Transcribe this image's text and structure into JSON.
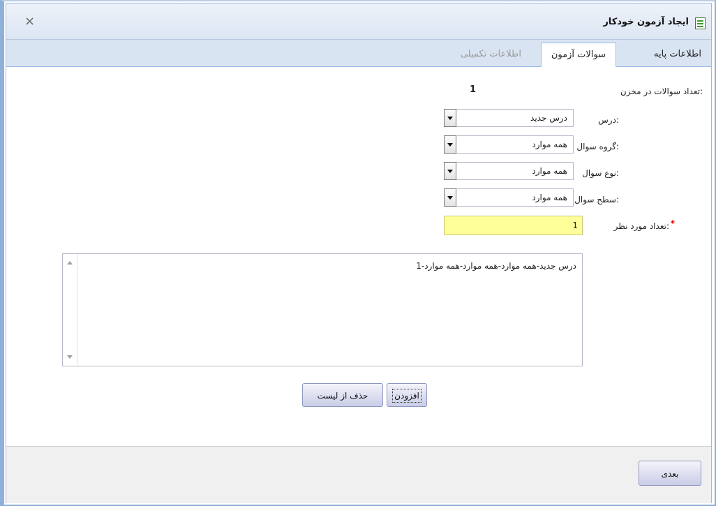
{
  "window": {
    "title": "ایجاد آزمون خودکار",
    "close_symbol": "×",
    "title_icon": "form-icon",
    "close_icon": "close-icon"
  },
  "tabs": [
    {
      "label": "اطلاعات پایه"
    },
    {
      "label": "سوالات آزمون"
    },
    {
      "label": "اطلاعات تکمیلی"
    }
  ],
  "form": {
    "bank_count_label": "تعداد سوالات در مخزن:",
    "bank_count_value": "1",
    "course_label": "درس:",
    "course_value": "درس جدید",
    "group_label": "گروه سوال:",
    "group_value": "همه موارد",
    "type_label": "نوع سوال:",
    "type_value": "همه موارد",
    "level_label": "سطح سوال:",
    "level_value": "همه موارد",
    "required_mark": "*",
    "desired_count_label": "تعداد مورد نظر:",
    "desired_count_value": "1"
  },
  "list": {
    "items": [
      "درس جدید-همه موارد-همه موارد-همه موارد-1"
    ]
  },
  "buttons": {
    "add": "افزودن",
    "remove": "حذف از لیست",
    "next": "بعدی"
  },
  "colors": {
    "required_field_bg": "#ffff99",
    "accent": "#99bbe8"
  }
}
